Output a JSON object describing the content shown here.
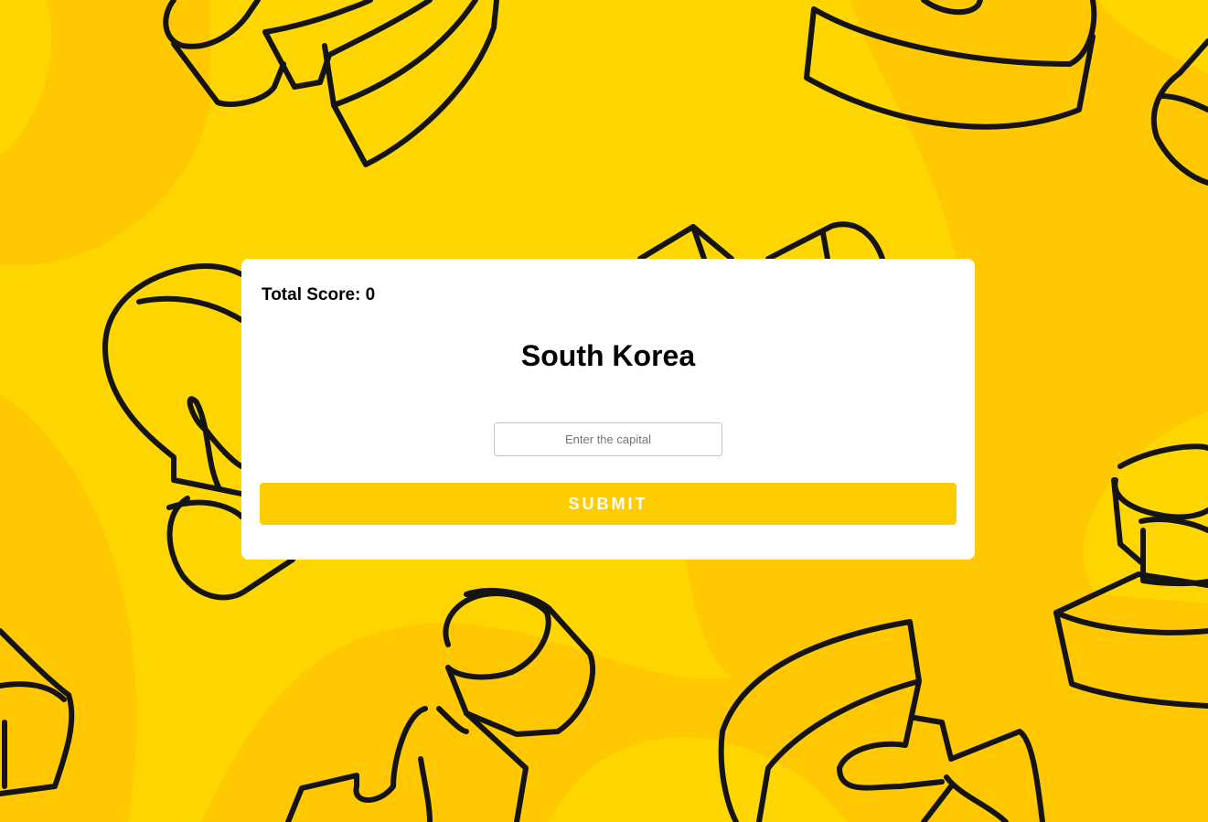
{
  "quiz": {
    "score_text": "Total Score: 0",
    "country": "South Korea",
    "input_placeholder": "Enter the capital",
    "input_value": "",
    "submit_label": "SUBMIT"
  },
  "colors": {
    "background": "#ffc800",
    "blob": "#ffd600",
    "outline": "#141414",
    "card": "#ffffff",
    "button": "#ffcc00",
    "button_text": "#ffffff"
  }
}
